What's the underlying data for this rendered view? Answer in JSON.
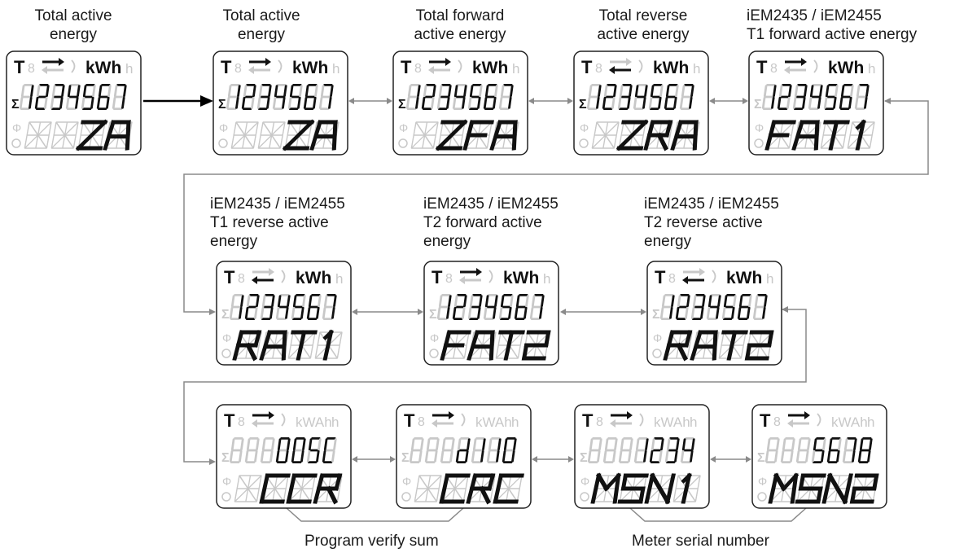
{
  "screens": [
    {
      "label": "Total active\nenergy",
      "unit": "kWhh",
      "dir": "fwd",
      "digits": "1234567",
      "mode": "ZA",
      "sigma": true
    },
    {
      "label": "Total active\nenergy",
      "unit": "kWhh",
      "dir": "fwd",
      "digits": "1234567",
      "mode": "ZA",
      "sigma": true
    },
    {
      "label": "Total forward\nactive energy",
      "unit": "kWhh",
      "dir": "fwd",
      "digits": "1234567",
      "mode": "ZFA",
      "sigma": true
    },
    {
      "label": "Total reverse\nactive energy",
      "unit": "kWhh",
      "dir": "rev",
      "digits": "1234567",
      "mode": "ZRA",
      "sigma": true
    },
    {
      "label": "iEM2435 / iEM2455\nT1 forward active energy",
      "unit": "kWhh",
      "dir": "fwd",
      "digits": "1234567",
      "mode": "FAT1",
      "sigma": false
    },
    {
      "label": "iEM2435 / iEM2455\nT1 reverse active\nenergy",
      "unit": "kWhh",
      "dir": "rev",
      "digits": "1234567",
      "mode": "RAT1",
      "sigma": false
    },
    {
      "label": "iEM2435 / iEM2455\nT2 forward active\nenergy",
      "unit": "kWhh",
      "dir": "fwd",
      "digits": "1234567",
      "mode": "FAT2",
      "sigma": false
    },
    {
      "label": "iEM2435 / iEM2455\nT2 reverse active\nenergy",
      "unit": "kWhh",
      "dir": "rev",
      "digits": "1234567",
      "mode": "RAT2",
      "sigma": false
    },
    {
      "label": "",
      "unit": "kWAhh",
      "dir": "fwd",
      "digits": "005C",
      "mode": "CCR",
      "sigma": false
    },
    {
      "label": "",
      "unit": "kWAhh",
      "dir": "fwd",
      "digits": "d110",
      "mode": "CRC",
      "sigma": false
    },
    {
      "label": "",
      "unit": "kWAhh",
      "dir": "fwd",
      "digits": "1234",
      "mode": "MSN1",
      "sigma": false
    },
    {
      "label": "",
      "unit": "kWAhh",
      "dir": "fwd",
      "digits": "5678",
      "mode": "MSN2",
      "sigma": false
    }
  ],
  "captions": {
    "program_verify": "Program verify sum",
    "meter_serial": "Meter serial number"
  },
  "colors": {
    "segment_on": "#111111",
    "segment_off": "#c8c8c8",
    "frame": "#222222",
    "connector": "#8a8a8a"
  }
}
